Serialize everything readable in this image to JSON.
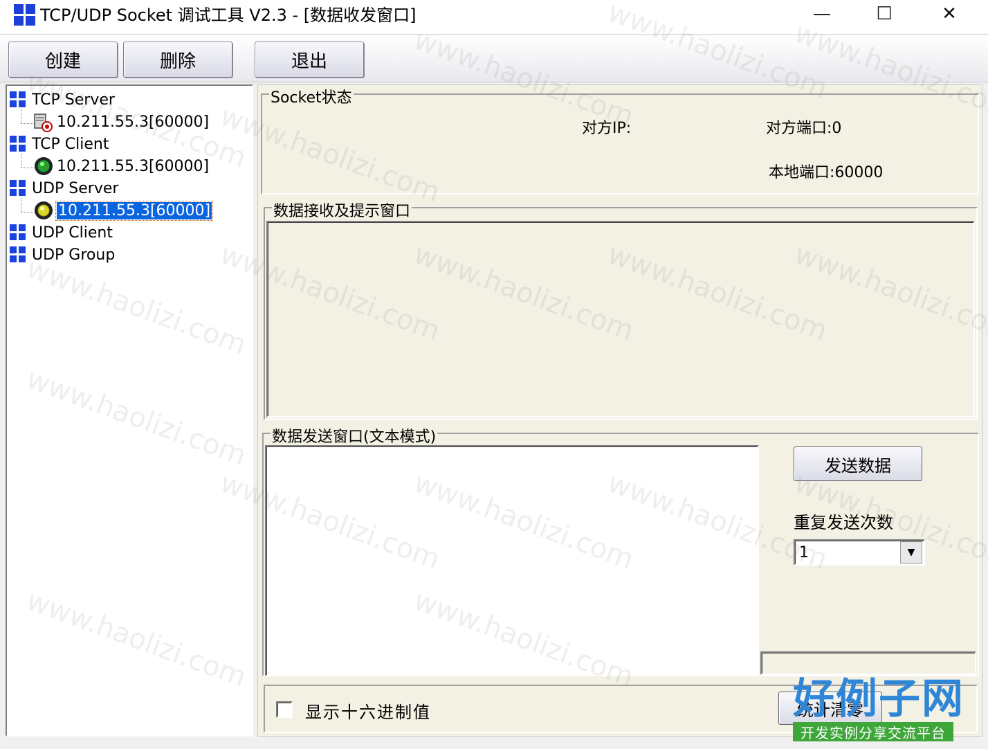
{
  "window": {
    "title": "TCP/UDP Socket 调试工具 V2.3 - [数据收发窗口]",
    "minimize_glyph": "—",
    "maximize_glyph": "☐",
    "close_glyph": "✕"
  },
  "toolbar": {
    "create_label": "创建",
    "delete_label": "删除",
    "exit_label": "退出"
  },
  "tree": {
    "groups": [
      {
        "label": "TCP Server",
        "children": [
          {
            "label": "10.211.55.3[60000]",
            "icon": "server-connection-icon"
          }
        ]
      },
      {
        "label": "TCP Client",
        "children": [
          {
            "label": "10.211.55.3[60000]",
            "icon": "client-connection-icon"
          }
        ]
      },
      {
        "label": "UDP Server",
        "children": [
          {
            "label": "10.211.55.3[60000]",
            "icon": "udp-connection-icon",
            "selected": true
          }
        ]
      },
      {
        "label": "UDP Client",
        "children": []
      },
      {
        "label": "UDP Group",
        "children": []
      }
    ]
  },
  "socket_status": {
    "title": "Socket状态",
    "remote_ip_label": "对方IP:",
    "remote_port_label": "对方端口:0",
    "local_port_label": "本地端口:60000"
  },
  "receive": {
    "title": "数据接收及提示窗口",
    "content": ""
  },
  "send": {
    "title": "数据发送窗口(文本模式)",
    "content": "",
    "send_button_label": "发送数据",
    "repeat_label": "重复发送次数",
    "repeat_value": "1",
    "status_value": ""
  },
  "bottom": {
    "hex_checkbox_label": "显示十六进制值",
    "hex_checked": false,
    "stats_button_label": "统计清零"
  },
  "watermark": "www.haolizi.com",
  "logo": {
    "main": "好例子网",
    "sub": "开发实例分享交流平台"
  },
  "colors": {
    "accent_blue": "#1a43e0",
    "selection_blue": "#0a64e0",
    "panel_bg": "#f3f1e3",
    "logo_blue": "#2f86d6",
    "logo_green": "#3fa63a"
  }
}
